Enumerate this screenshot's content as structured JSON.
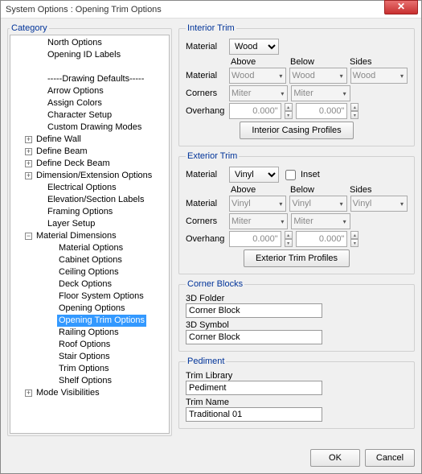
{
  "window": {
    "title": "System Options : Opening Trim Options"
  },
  "category": {
    "legend": "Category",
    "nodes": [
      {
        "label": "North Options",
        "indent": 28,
        "twisty": "none"
      },
      {
        "label": "Opening ID Labels",
        "indent": 28,
        "twisty": "none"
      },
      {
        "label": "",
        "indent": 28,
        "twisty": "none"
      },
      {
        "label": "-----Drawing Defaults-----",
        "indent": 28,
        "twisty": "none"
      },
      {
        "label": "Arrow Options",
        "indent": 28,
        "twisty": "none"
      },
      {
        "label": "Assign Colors",
        "indent": 28,
        "twisty": "none"
      },
      {
        "label": "Character Setup",
        "indent": 28,
        "twisty": "none"
      },
      {
        "label": "Custom Drawing Modes",
        "indent": 28,
        "twisty": "none"
      },
      {
        "label": "Define Wall",
        "indent": 14,
        "twisty": "plus"
      },
      {
        "label": "Define Beam",
        "indent": 14,
        "twisty": "plus"
      },
      {
        "label": "Define Deck Beam",
        "indent": 14,
        "twisty": "plus"
      },
      {
        "label": "Dimension/Extension Options",
        "indent": 14,
        "twisty": "plus"
      },
      {
        "label": "Electrical Options",
        "indent": 28,
        "twisty": "none"
      },
      {
        "label": "Elevation/Section Labels",
        "indent": 28,
        "twisty": "none"
      },
      {
        "label": "Framing Options",
        "indent": 28,
        "twisty": "none"
      },
      {
        "label": "Layer Setup",
        "indent": 28,
        "twisty": "none"
      },
      {
        "label": "Material Dimensions",
        "indent": 14,
        "twisty": "minus"
      },
      {
        "label": "Material Options",
        "indent": 42,
        "twisty": "none"
      },
      {
        "label": "Cabinet Options",
        "indent": 42,
        "twisty": "none"
      },
      {
        "label": "Ceiling Options",
        "indent": 42,
        "twisty": "none"
      },
      {
        "label": "Deck Options",
        "indent": 42,
        "twisty": "none"
      },
      {
        "label": "Floor System Options",
        "indent": 42,
        "twisty": "none"
      },
      {
        "label": "Opening Options",
        "indent": 42,
        "twisty": "none"
      },
      {
        "label": "Opening Trim Options",
        "indent": 42,
        "twisty": "none",
        "selected": true
      },
      {
        "label": "Railing Options",
        "indent": 42,
        "twisty": "none"
      },
      {
        "label": "Roof Options",
        "indent": 42,
        "twisty": "none"
      },
      {
        "label": "Stair Options",
        "indent": 42,
        "twisty": "none"
      },
      {
        "label": "Trim Options",
        "indent": 42,
        "twisty": "none"
      },
      {
        "label": "Shelf Options",
        "indent": 42,
        "twisty": "none"
      },
      {
        "label": "Mode Visibilities",
        "indent": 14,
        "twisty": "plus"
      }
    ]
  },
  "interior": {
    "legend": "Interior Trim",
    "material_label": "Material",
    "material_value": "Wood",
    "cols": {
      "above": "Above",
      "below": "Below",
      "sides": "Sides"
    },
    "material2_label": "Material",
    "material2": {
      "above": "Wood",
      "below": "Wood",
      "sides": "Wood"
    },
    "corners_label": "Corners",
    "corners": {
      "above": "Miter",
      "below": "Miter"
    },
    "overhang_label": "Overhang",
    "overhang": {
      "above": "0.000\"",
      "below": "0.000\""
    },
    "profiles_btn": "Interior Casing Profiles"
  },
  "exterior": {
    "legend": "Exterior Trim",
    "material_label": "Material",
    "material_value": "Vinyl",
    "inset_label": "Inset",
    "cols": {
      "above": "Above",
      "below": "Below",
      "sides": "Sides"
    },
    "material2_label": "Material",
    "material2": {
      "above": "Vinyl",
      "below": "Vinyl",
      "sides": "Vinyl"
    },
    "corners_label": "Corners",
    "corners": {
      "above": "Miter",
      "below": "Miter"
    },
    "overhang_label": "Overhang",
    "overhang": {
      "above": "0.000\"",
      "below": "0.000\""
    },
    "profiles_btn": "Exterior Trim Profiles"
  },
  "corner_blocks": {
    "legend": "Corner Blocks",
    "folder_label": "3D Folder",
    "folder_value": "Corner Block",
    "symbol_label": "3D Symbol",
    "symbol_value": "Corner Block"
  },
  "pediment": {
    "legend": "Pediment",
    "lib_label": "Trim Library",
    "lib_value": "Pediment",
    "name_label": "Trim Name",
    "name_value": "Traditional 01"
  },
  "footer": {
    "ok": "OK",
    "cancel": "Cancel"
  }
}
